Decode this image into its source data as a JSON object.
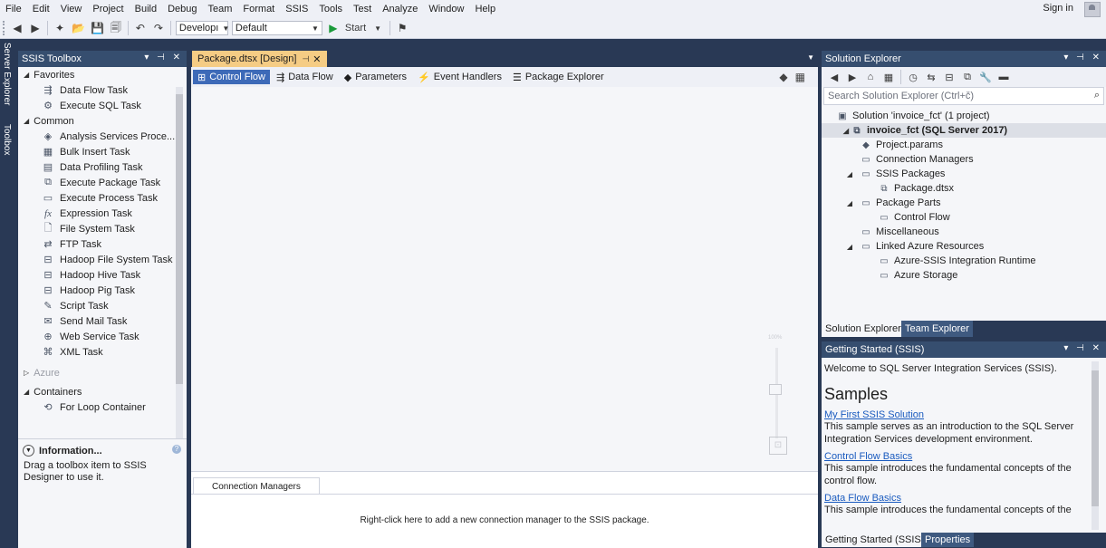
{
  "menu": [
    "File",
    "Edit",
    "View",
    "Project",
    "Build",
    "Debug",
    "Team",
    "Format",
    "SSIS",
    "Tools",
    "Test",
    "Analyze",
    "Window",
    "Help"
  ],
  "signin": "Sign in",
  "toolbar": {
    "solution_config": "Developı",
    "platform": "Default",
    "start_label": "Start"
  },
  "leftstrip": {
    "server_explorer": "Server Explorer",
    "toolbox": "Toolbox"
  },
  "ssis_toolbox": {
    "title": "SSIS Toolbox",
    "favorites": {
      "label": "Favorites",
      "items": [
        {
          "label": "Data Flow Task",
          "icon": "data-flow-icon"
        },
        {
          "label": "Execute SQL Task",
          "icon": "sql-task-icon"
        }
      ]
    },
    "common": {
      "label": "Common",
      "items": [
        {
          "label": "Analysis Services Proce...",
          "icon": "cube-icon"
        },
        {
          "label": "Bulk Insert Task",
          "icon": "bulk-insert-icon"
        },
        {
          "label": "Data Profiling Task",
          "icon": "profiling-icon"
        },
        {
          "label": "Execute Package Task",
          "icon": "package-icon"
        },
        {
          "label": "Execute Process Task",
          "icon": "process-icon"
        },
        {
          "label": "Expression Task",
          "icon": "fx-icon"
        },
        {
          "label": "File System Task",
          "icon": "file-icon"
        },
        {
          "label": "FTP Task",
          "icon": "ftp-icon"
        },
        {
          "label": "Hadoop File System Task",
          "icon": "hadoop-icon"
        },
        {
          "label": "Hadoop Hive Task",
          "icon": "hive-icon"
        },
        {
          "label": "Hadoop Pig Task",
          "icon": "pig-icon"
        },
        {
          "label": "Script Task",
          "icon": "script-icon"
        },
        {
          "label": "Send Mail Task",
          "icon": "mail-icon"
        },
        {
          "label": "Web Service Task",
          "icon": "web-icon"
        },
        {
          "label": "XML Task",
          "icon": "xml-icon"
        }
      ]
    },
    "azure": {
      "label": "Azure"
    },
    "containers": {
      "label": "Containers",
      "items": [
        {
          "label": "For Loop Container",
          "icon": "loop-icon"
        }
      ]
    },
    "information": {
      "title": "Information...",
      "text": "Drag a toolbox item to SSIS Designer to use it."
    }
  },
  "doc_tab": "Package.dtsx [Design]",
  "design_tabs": [
    "Control Flow",
    "Data Flow",
    "Parameters",
    "Event Handlers",
    "Package Explorer"
  ],
  "zoom": "100%",
  "connection_managers": {
    "tab": "Connection Managers",
    "hint": "Right-click here to add a new connection manager to the SSIS package."
  },
  "solution_explorer": {
    "title": "Solution Explorer",
    "search_placeholder": "Search Solution Explorer (Ctrl+č)",
    "tree": [
      {
        "label": "Solution 'invoice_fct' (1 project)",
        "depth": 0,
        "expander": ""
      },
      {
        "label": "invoice_fct (SQL Server 2017)",
        "depth": 0,
        "expander": "▲",
        "selected": true
      },
      {
        "label": "Project.params",
        "depth": 2,
        "expander": ""
      },
      {
        "label": "Connection Managers",
        "depth": 2,
        "expander": ""
      },
      {
        "label": "SSIS Packages",
        "depth": 1,
        "expander": "▲"
      },
      {
        "label": "Package.dtsx",
        "depth": 3,
        "expander": ""
      },
      {
        "label": "Package Parts",
        "depth": 1,
        "expander": "▲"
      },
      {
        "label": "Control Flow",
        "depth": 3,
        "expander": ""
      },
      {
        "label": "Miscellaneous",
        "depth": 2,
        "expander": ""
      },
      {
        "label": "Linked Azure Resources",
        "depth": 1,
        "expander": "▲"
      },
      {
        "label": "Azure-SSIS Integration Runtime",
        "depth": 3,
        "expander": ""
      },
      {
        "label": "Azure Storage",
        "depth": 3,
        "expander": ""
      }
    ],
    "bottom_tabs": [
      "Solution Explorer",
      "Team Explorer"
    ]
  },
  "getting_started": {
    "title": "Getting Started (SSIS)",
    "welcome": "Welcome to SQL Server Integration Services (SSIS).",
    "heading": "Samples",
    "samples": [
      {
        "link": "My First SSIS Solution",
        "desc": "This sample serves as an introduction to the SQL Server Integration Services development environment."
      },
      {
        "link": "Control Flow Basics",
        "desc": "This sample introduces the fundamental concepts of the control flow."
      },
      {
        "link": "Data Flow Basics",
        "desc": "This sample introduces the fundamental concepts of the"
      }
    ],
    "bottom_tabs": [
      "Getting Started (SSIS)",
      "Properties"
    ]
  }
}
